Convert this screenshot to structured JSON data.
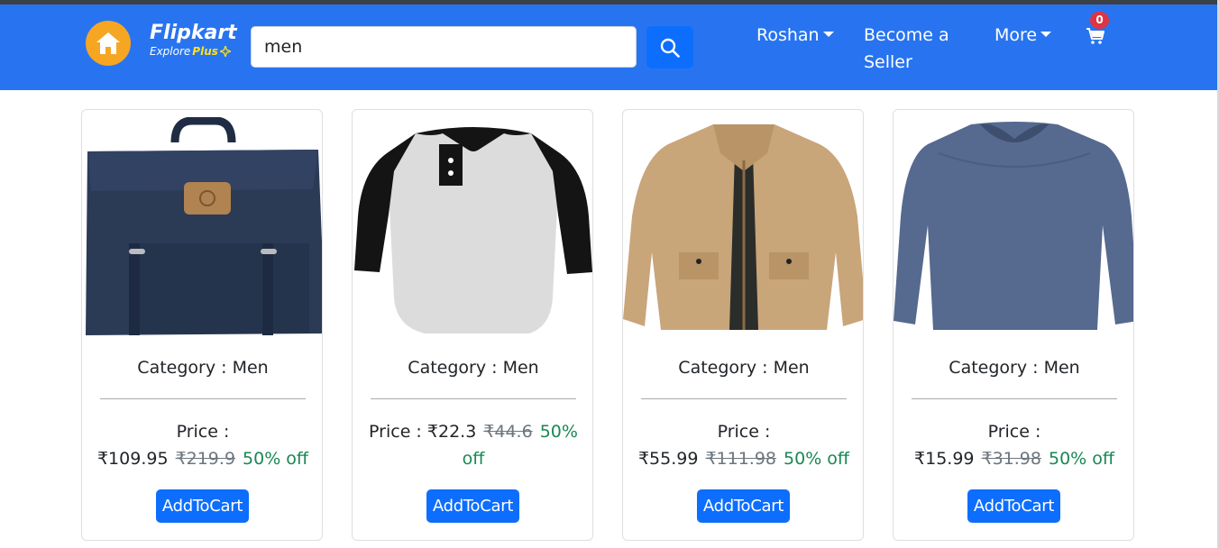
{
  "header": {
    "brand": "Flipkart",
    "tagline_prefix": "Explore",
    "tagline_plus": "Plus",
    "search_value": "men",
    "nav": {
      "user": "Roshan",
      "seller_line1": "Become a",
      "seller_line2": "Seller",
      "more": "More"
    },
    "cart_count": "0"
  },
  "colors": {
    "navbar": "#2874f0",
    "home_icon_bg": "#f6a623",
    "primary_button": "#0d6efd",
    "discount_text": "#198754",
    "badge": "#dc3545"
  },
  "products": [
    {
      "image": "navy-backpack",
      "category": "Category : Men",
      "price_label": "Price :",
      "price": "₹109.95",
      "old_price": "₹219.9",
      "discount": "50% off",
      "button": "AddToCart"
    },
    {
      "image": "raglan-henley-tshirt",
      "category": "Category : Men",
      "price_label": "Price :",
      "price": "₹22.3",
      "old_price": "₹44.6",
      "discount": "50% off",
      "button": "AddToCart"
    },
    {
      "image": "khaki-jacket",
      "category": "Category : Men",
      "price_label": "Price :",
      "price": "₹55.99",
      "old_price": "₹111.98",
      "discount": "50% off",
      "button": "AddToCart"
    },
    {
      "image": "blue-long-sleeve-tshirt",
      "category": "Category : Men",
      "price_label": "Price :",
      "price": "₹15.99",
      "old_price": "₹31.98",
      "discount": "50% off",
      "button": "AddToCart"
    }
  ]
}
